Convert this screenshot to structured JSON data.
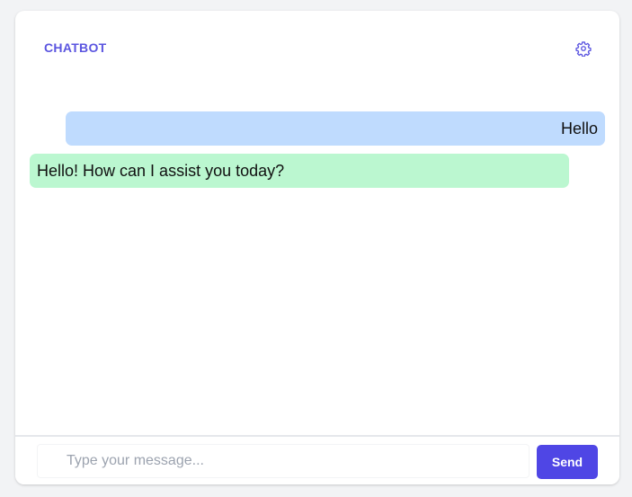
{
  "header": {
    "title": "CHATBOT",
    "settings_icon": "gear-icon"
  },
  "messages": [
    {
      "role": "user",
      "text": "Hello"
    },
    {
      "role": "bot",
      "text": "Hello! How can I assist you today?"
    }
  ],
  "composer": {
    "placeholder": "Type your message...",
    "value": "",
    "send_label": "Send"
  },
  "colors": {
    "accent": "#4f46e5",
    "user_bubble": "#bfdbfe",
    "bot_bubble": "#bbf7d0"
  }
}
